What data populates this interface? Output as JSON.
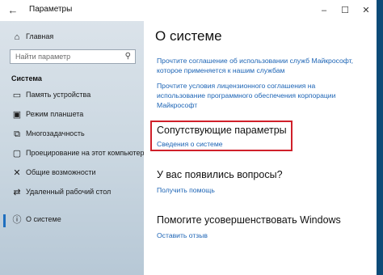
{
  "window": {
    "title": "Параметры",
    "controls": [
      "–",
      "☐",
      "✕"
    ]
  },
  "sidebar": {
    "home_label": "Главная",
    "search_placeholder": "Найти параметр",
    "section_title": "Система",
    "items": [
      {
        "icon": "display-icon",
        "label": "Память устройства"
      },
      {
        "icon": "tablet-mode-icon",
        "label": "Режим планшета"
      },
      {
        "icon": "multitasking-icon",
        "label": "Многозадачность"
      },
      {
        "icon": "projection-icon",
        "label": "Проецирование на этот компьютер"
      },
      {
        "icon": "shared-experiences-icon",
        "label": "Общие возможности"
      },
      {
        "icon": "remote-desktop-icon",
        "label": "Удаленный рабочий стол"
      },
      {
        "icon": "info-icon",
        "label": "О системе"
      }
    ]
  },
  "content": {
    "title": "О системе",
    "link1": "Прочтите соглашение об использовании служб Майкрософт, которое применяется к нашим службам",
    "link2": "Прочтите условия лицензионного соглашения на использование программного обеспечения корпорации Майкрософт",
    "related_title": "Сопутствующие параметры",
    "related_link": "Сведения о системе",
    "questions_title": "У вас появились вопросы?",
    "help_link": "Получить помощь",
    "improve_title": "Помогите усовершенствовать Windows",
    "feedback_link": "Оставить отзыв"
  },
  "colors": {
    "accent": "#1c64b5",
    "highlight": "#d0202a"
  }
}
